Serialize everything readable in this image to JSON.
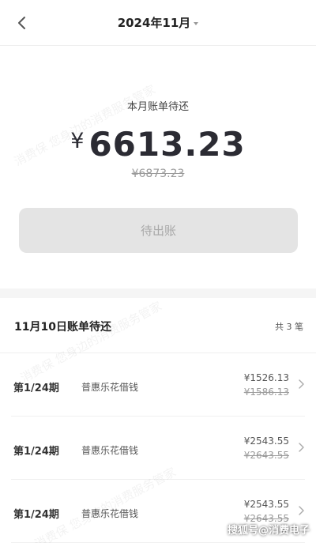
{
  "header": {
    "title": "2024年11月"
  },
  "summary": {
    "label": "本月账单待还",
    "currency": "¥",
    "amount": "6613.23",
    "original_amount": "¥6873.23",
    "button_label": "待出账"
  },
  "bill_section": {
    "title": "11月10日账单待还",
    "count_label": "共 3 笔",
    "rows": [
      {
        "period": "第1/24期",
        "product": "普惠乐花借钱",
        "amount": "¥1526.13",
        "original": "¥1586.13"
      },
      {
        "period": "第1/24期",
        "product": "普惠乐花借钱",
        "amount": "¥2543.55",
        "original": "¥2643.55"
      },
      {
        "period": "第1/24期",
        "product": "普惠乐花借钱",
        "amount": "¥2543.55",
        "original": "¥2643.55"
      }
    ]
  },
  "watermark": "消费保 您身边的消费服务管家",
  "footer_credit": "搜狐号@消费电子",
  "icons": {
    "back": "chevron-left-icon",
    "dropdown": "caret-down-icon",
    "row": "chevron-right-icon"
  },
  "colors": {
    "amount": "#2b2b33",
    "disabled_button": "#e4e4e4",
    "page_background": "#f5f5f5"
  }
}
